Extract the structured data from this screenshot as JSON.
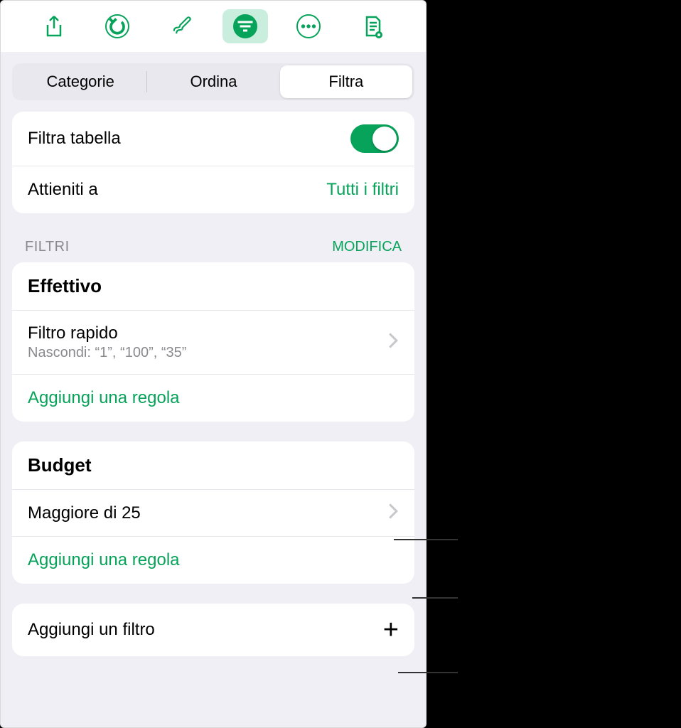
{
  "toolbar": {
    "icons": [
      "share-icon",
      "undo-icon",
      "brush-icon",
      "filter-icon",
      "more-icon",
      "document-icon"
    ]
  },
  "segment": {
    "items": [
      "Categorie",
      "Ordina",
      "Filtra"
    ],
    "active_index": 2
  },
  "filter_table": {
    "label": "Filtra tabella",
    "toggle_on": true
  },
  "adhere": {
    "label": "Attieniti a",
    "value": "Tutti i filtri"
  },
  "section_filters": {
    "title": "FILTRI",
    "edit": "MODIFICA"
  },
  "group_effettivo": {
    "title": "Effettivo",
    "quick_filter_label": "Filtro rapido",
    "quick_filter_sub": "Nascondi: “1”, “100”, “35”",
    "add_rule": "Aggiungi una regola"
  },
  "group_budget": {
    "title": "Budget",
    "rule1": "Maggiore di 25",
    "add_rule": "Aggiungi una regola"
  },
  "add_filter": {
    "label": "Aggiungi un filtro"
  }
}
